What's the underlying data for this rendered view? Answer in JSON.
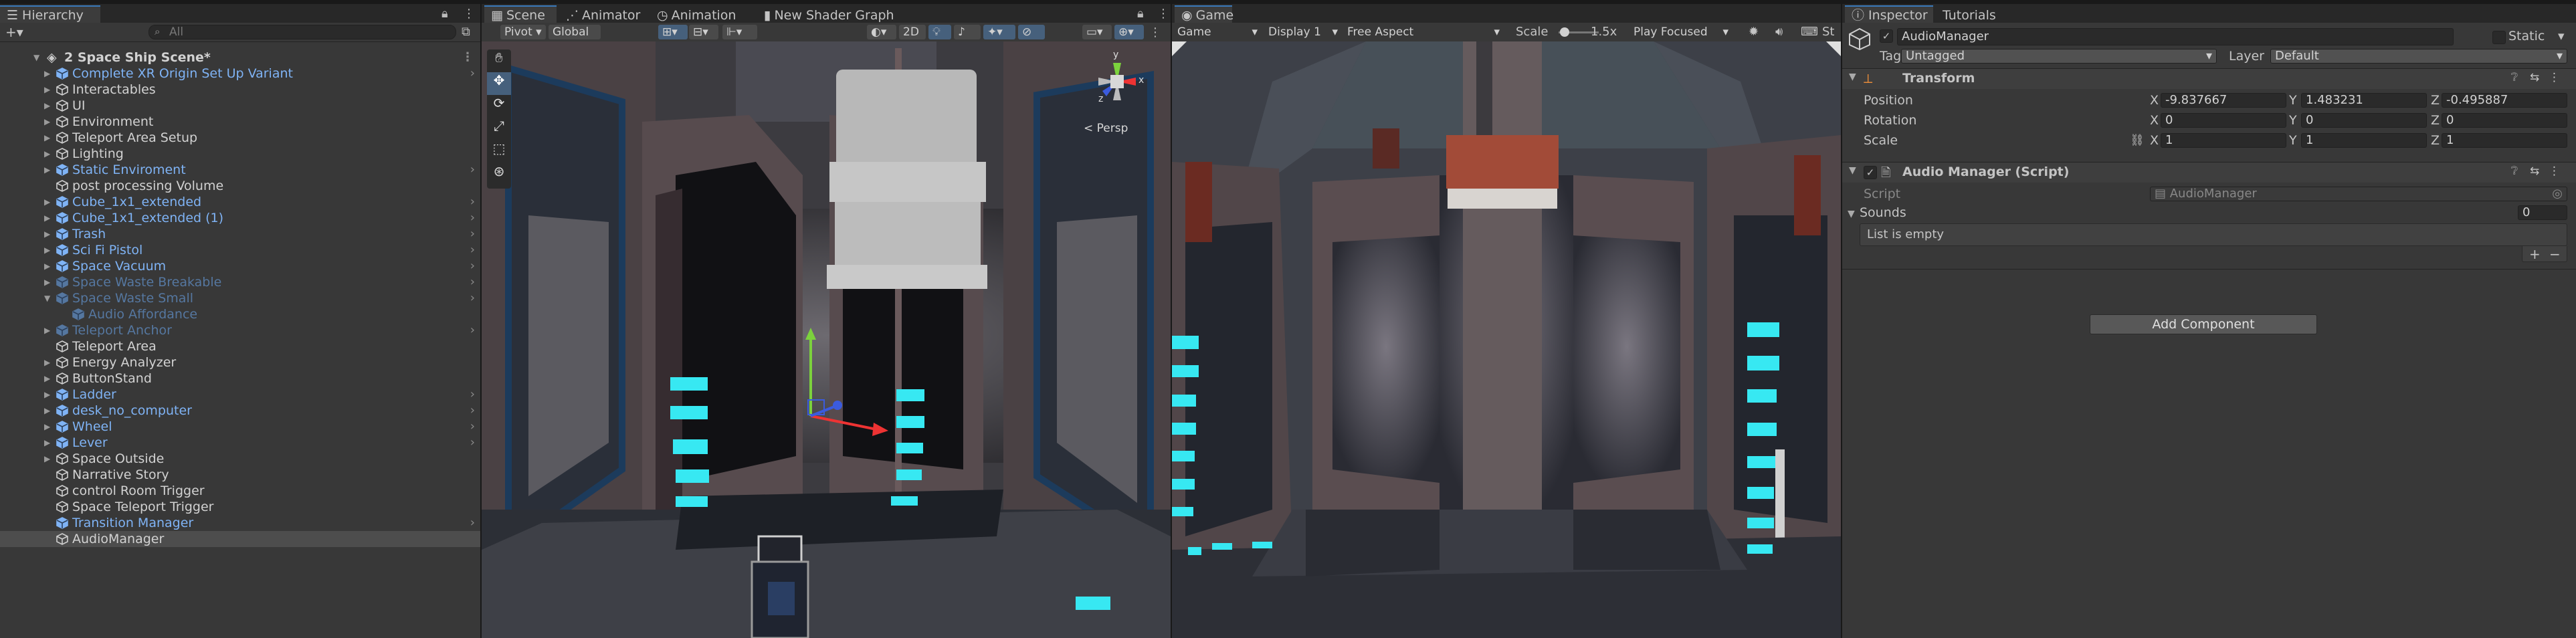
{
  "hierarchy": {
    "tab": "Hierarchy",
    "search_placeholder": "All",
    "add_label": "+▾",
    "scene_name": "2 Space Ship Scene*",
    "items": [
      {
        "label": "Complete XR Origin Set Up Variant",
        "kind": "prefab",
        "depth": 1,
        "arrow": true,
        "chev": true
      },
      {
        "label": "Interactables",
        "kind": "normal",
        "depth": 1,
        "arrow": true,
        "chev": false
      },
      {
        "label": "UI",
        "kind": "normal",
        "depth": 1,
        "arrow": true,
        "chev": false
      },
      {
        "label": "Environment",
        "kind": "normal",
        "depth": 1,
        "arrow": true,
        "chev": false
      },
      {
        "label": "Teleport Area Setup",
        "kind": "normal",
        "depth": 1,
        "arrow": true,
        "chev": false
      },
      {
        "label": "Lighting",
        "kind": "normal",
        "depth": 1,
        "arrow": true,
        "chev": false
      },
      {
        "label": "Static Enviroment",
        "kind": "prefab",
        "depth": 1,
        "arrow": true,
        "chev": true
      },
      {
        "label": "post processing Volume",
        "kind": "normal",
        "depth": 1,
        "arrow": false,
        "chev": false
      },
      {
        "label": "Cube_1x1_extended",
        "kind": "prefab",
        "depth": 1,
        "arrow": true,
        "chev": true
      },
      {
        "label": "Cube_1x1_extended (1)",
        "kind": "prefab",
        "depth": 1,
        "arrow": true,
        "chev": true
      },
      {
        "label": "Trash",
        "kind": "prefab",
        "depth": 1,
        "arrow": true,
        "chev": true
      },
      {
        "label": "Sci Fi Pistol",
        "kind": "prefab",
        "depth": 1,
        "arrow": true,
        "chev": true
      },
      {
        "label": "Space Vacuum",
        "kind": "prefab",
        "depth": 1,
        "arrow": true,
        "chev": true
      },
      {
        "label": "Space Waste Breakable",
        "kind": "prefab-dim",
        "depth": 1,
        "arrow": true,
        "chev": true
      },
      {
        "label": "Space Waste Small",
        "kind": "prefab-dim",
        "depth": 1,
        "arrow": "open",
        "chev": true
      },
      {
        "label": "Audio Affordance",
        "kind": "prefab-dim",
        "depth": 2,
        "arrow": false,
        "chev": false
      },
      {
        "label": "Teleport Anchor",
        "kind": "prefab-dim",
        "depth": 1,
        "arrow": true,
        "chev": true
      },
      {
        "label": "Teleport Area",
        "kind": "normal",
        "depth": 1,
        "arrow": false,
        "chev": false
      },
      {
        "label": "Energy Analyzer",
        "kind": "normal",
        "depth": 1,
        "arrow": true,
        "chev": false
      },
      {
        "label": "ButtonStand",
        "kind": "normal",
        "depth": 1,
        "arrow": true,
        "chev": false
      },
      {
        "label": "Ladder",
        "kind": "prefab",
        "depth": 1,
        "arrow": true,
        "chev": true
      },
      {
        "label": "desk_no_computer",
        "kind": "prefab",
        "depth": 1,
        "arrow": true,
        "chev": true
      },
      {
        "label": "Wheel",
        "kind": "prefab",
        "depth": 1,
        "arrow": true,
        "chev": true
      },
      {
        "label": "Lever",
        "kind": "prefab",
        "depth": 1,
        "arrow": true,
        "chev": true
      },
      {
        "label": "Space Outside",
        "kind": "normal",
        "depth": 1,
        "arrow": true,
        "chev": false
      },
      {
        "label": "Narrative Story",
        "kind": "normal",
        "depth": 1,
        "arrow": false,
        "chev": false
      },
      {
        "label": "control Room Trigger",
        "kind": "normal",
        "depth": 1,
        "arrow": false,
        "chev": false
      },
      {
        "label": "Space Teleport Trigger",
        "kind": "normal",
        "depth": 1,
        "arrow": false,
        "chev": false
      },
      {
        "label": "Transition Manager",
        "kind": "prefab",
        "depth": 1,
        "arrow": false,
        "chev": true
      },
      {
        "label": "AudioManager",
        "kind": "normal",
        "depth": 1,
        "arrow": false,
        "chev": false,
        "selected": true
      }
    ]
  },
  "scene": {
    "tabs": [
      "Scene",
      "Animator",
      "Animation",
      "New Shader Graph"
    ],
    "pivot": "Pivot",
    "global": "Global",
    "mode_2d": "2D",
    "persp": "< Persp",
    "gizmo_axes": {
      "x": "x",
      "y": "y",
      "z": "z"
    }
  },
  "game": {
    "tab": "Game",
    "display_mode": "Game",
    "display": "Display 1",
    "aspect": "Free Aspect",
    "scale_label": "Scale",
    "scale_value": "1.5x",
    "play_mode": "Play Focused",
    "stats_label": "St"
  },
  "inspector": {
    "tabs": [
      "Inspector",
      "Tutorials"
    ],
    "object_name": "AudioManager",
    "static_label": "Static",
    "tag_label": "Tag",
    "tag_value": "Untagged",
    "layer_label": "Layer",
    "layer_value": "Default",
    "transform": {
      "title": "Transform",
      "position_label": "Position",
      "rotation_label": "Rotation",
      "scale_label": "Scale",
      "position": {
        "x": "-9.837667",
        "y": "1.483231",
        "z": "-0.495887"
      },
      "rotation": {
        "x": "0",
        "y": "0",
        "z": "0"
      },
      "scale": {
        "x": "1",
        "y": "1",
        "z": "1"
      },
      "axis_x": "X",
      "axis_y": "Y",
      "axis_z": "Z"
    },
    "audio_manager": {
      "title": "Audio Manager (Script)",
      "script_label": "Script",
      "script_value": "AudioManager",
      "sounds_label": "Sounds",
      "sounds_count": "0",
      "empty_text": "List is empty",
      "plus": "+",
      "minus": "−"
    },
    "add_component": "Add Component"
  },
  "colors": {
    "accent_blue": "#3a79bb",
    "prefab_blue": "#7fb3f5",
    "neon_cyan": "#37e8f2",
    "panel": "#383838"
  }
}
